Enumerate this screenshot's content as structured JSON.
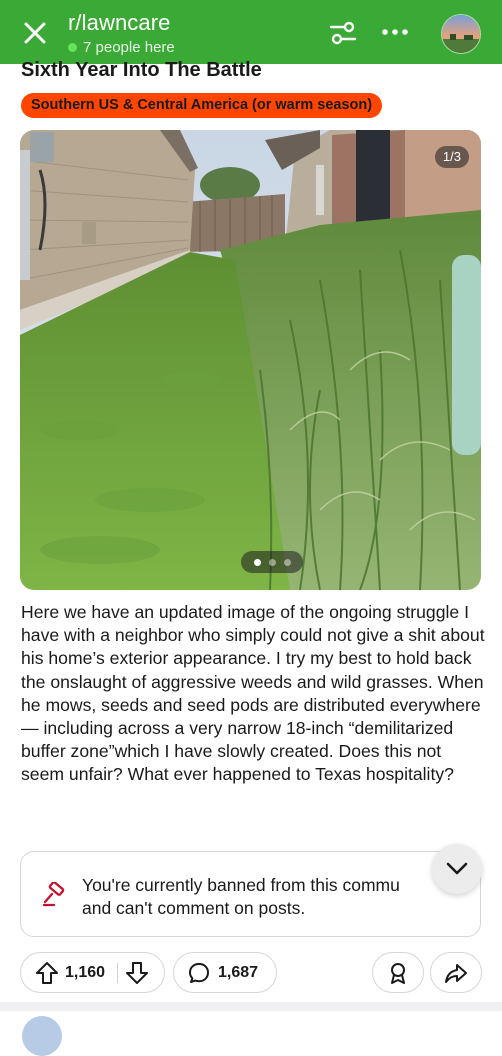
{
  "header": {
    "subreddit": "r/lawncare",
    "online_count": "7 people here",
    "accent_color": "#3aa935",
    "icons": [
      "close-icon",
      "filter-sliders-icon",
      "more-horizontal-icon"
    ]
  },
  "post": {
    "title": "Sixth Year Into The Battle",
    "flair": "Southern US & Central America (or warm season)",
    "flair_color": "#ff4500",
    "image_counter": "1/3",
    "image_count": 3,
    "active_image": 1,
    "body": "Here we have an updated image of the ongoing struggle I have with a neighbor who simply could not give a shit about his home’s exterior appearance. I try my best to hold back the onslaught of aggressive weeds and wild grasses. When he mows, seeds and seed pods are distributed everywhere — including across a very narrow 18-inch “demilitarized buffer zone”which I have slowly created. Does this not seem unfair? What ever happened to Texas hospitality?"
  },
  "banned_notice": {
    "icon": "gavel-icon",
    "text_line1": "You're currently banned from this commu",
    "text_line2": "and can't comment on posts."
  },
  "actions": {
    "upvotes": "1,160",
    "comments": "1,687",
    "icons": [
      "upvote-icon",
      "downvote-icon",
      "comment-icon",
      "award-icon",
      "share-icon",
      "chevron-down-icon"
    ]
  }
}
